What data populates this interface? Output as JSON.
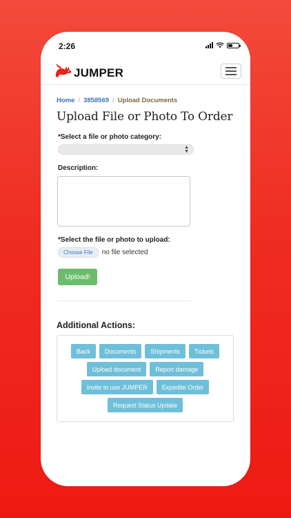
{
  "status_bar": {
    "time": "2:26"
  },
  "brand": {
    "name": "JUMPER",
    "accent": "#e8241b"
  },
  "breadcrumb": {
    "home": "Home",
    "order": "3858569",
    "current": "Upload Documents",
    "separator": "/"
  },
  "page_title": "Upload File or Photo To Order",
  "form": {
    "category_label": "*Select a file or photo category:",
    "category_value": "",
    "description_label": "Description:",
    "description_value": "",
    "file_label": "*Select the file or photo to upload:",
    "choose_file_label": "Choose File",
    "file_status": "no file selected",
    "upload_label": "Upload!"
  },
  "additional_actions": {
    "title": "Additional Actions:",
    "buttons": {
      "back": "Back",
      "documents": "Documents",
      "shipments": "Shipments",
      "tickets": "Tickets",
      "upload_document": "Upload document",
      "report_damage": "Report damage",
      "invite": "Invite to use JUMPER",
      "expedite": "Expedite Order",
      "request_status": "Request Status Update"
    }
  },
  "colors": {
    "background_top": "#f24a3c",
    "background_bottom": "#ee1a12",
    "link": "#3b72b8",
    "upload_button": "#6cbc6c",
    "action_button": "#6fbfd9"
  }
}
